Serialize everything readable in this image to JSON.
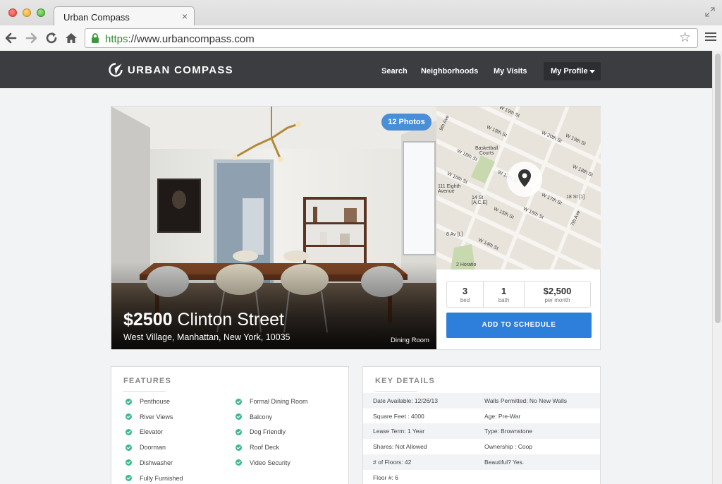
{
  "browser": {
    "tab_title": "Urban Compass",
    "tab_close": "×",
    "url_scheme": "https",
    "url_rest": "://www.urbancompass.com",
    "star": "☆"
  },
  "header": {
    "logo_text": "URBAN COMPASS",
    "nav": {
      "search": "Search",
      "neighborhoods": "Neighborhoods",
      "my_visits": "My Visits",
      "my_profile": "My Profile"
    }
  },
  "listing": {
    "photos_badge": "12 Photos",
    "price": "$2500",
    "street": "Clinton Street",
    "address": "West Village, Manhattan, New York, 10035",
    "room_label": "Dining Room",
    "stats": {
      "beds_value": "3",
      "beds_label": "bed",
      "baths_value": "1",
      "baths_label": "bath",
      "rent_value": "$2,500",
      "rent_label": "per month"
    },
    "schedule_button": "ADD TO SCHEDULE"
  },
  "map": {
    "labels": {
      "w19th_a": "W 19th St",
      "w18th_a": "W 18th St",
      "w20th": "W 20th St",
      "w19th_b": "W 19th St",
      "w18th_b": "W 18th St",
      "w17th_a": "W 17th St",
      "basketball": "Basketball\nCourts",
      "w16th_a": "W 16th St",
      "eighth_ave": "111 Eighth\nAvenue",
      "fourteenth": "14 St\n[A,C,E]",
      "w16th_b": "W 16th St",
      "w17th_b": "W 17th St",
      "w15th": "W 15th St",
      "w16th_c": "W 16th St",
      "eighteenth": "18 St [1]",
      "seventh_ave": "7th Ave",
      "eighth_ave_l": "8 Av [L]",
      "w14th": "W 14th St",
      "horatio": "2 Horatio",
      "ninth_ave": "9th Ave"
    }
  },
  "features": {
    "title": "FEATURES",
    "left": [
      "Penthouse",
      "River Views",
      "Elevator",
      "Doorman",
      "Dishwasher",
      "Fully Furnished"
    ],
    "right": [
      "Formal Dining Room",
      "Balcony",
      "Dog Friendly",
      "Roof Deck",
      "Video Security"
    ]
  },
  "key_details": {
    "title": "KEY DETAILS",
    "rows": [
      [
        "Date Available: 12/26/13",
        "Walls Permitted: No New Walls"
      ],
      [
        "Square Feet : 4000",
        "Age: Pre-War"
      ],
      [
        "Lease Term: 1 Year",
        "Type: Brownstone"
      ],
      [
        "Shares: Not Allowed",
        "Ownership : Coop"
      ],
      [
        "# of Floors: 42",
        "Beautiful? Yes."
      ],
      [
        "Floor #: 6",
        ""
      ]
    ]
  },
  "colors": {
    "header_bg": "#3b3d40",
    "accent_blue": "#2d7fdb",
    "check_green": "#3bb88a",
    "page_bg": "#f2f3f5"
  }
}
